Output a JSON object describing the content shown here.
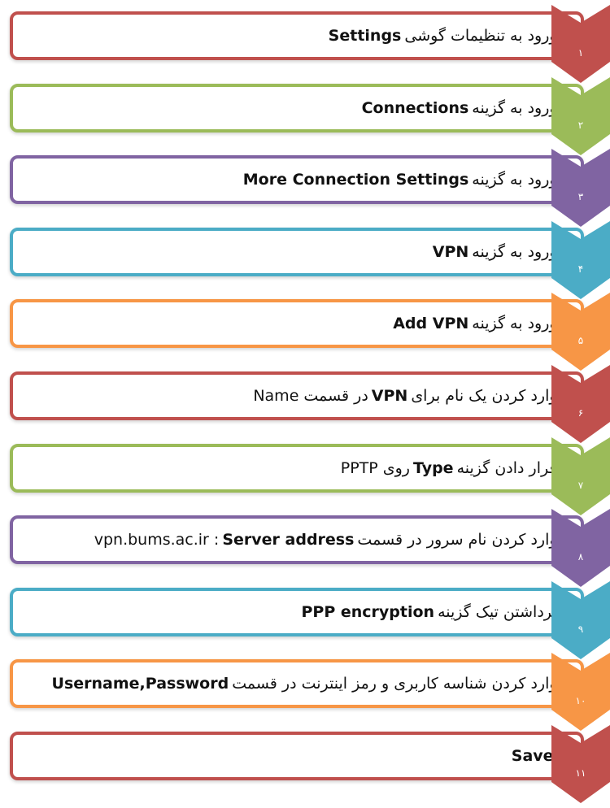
{
  "colors": {
    "red": "#c0504d",
    "green": "#9bbb59",
    "purple": "#8064a2",
    "blue": "#4bacc6",
    "orange": "#f79646"
  },
  "steps": [
    {
      "number": "۱",
      "color": "red",
      "fa": "ورود به تنظیمات گوشی",
      "en": "Settings",
      "tail": ""
    },
    {
      "number": "۲",
      "color": "green",
      "fa": "ورود به گزینه",
      "en": "Connections",
      "tail": ""
    },
    {
      "number": "۳",
      "color": "purple",
      "fa": "ورود به گزینه",
      "en": "More Connection Settings",
      "tail": ""
    },
    {
      "number": "۴",
      "color": "blue",
      "fa": "ورود به گزینه",
      "en": "VPN",
      "tail": ""
    },
    {
      "number": "۵",
      "color": "orange",
      "fa": "ورود به گزینه",
      "en": "Add VPN",
      "tail": ""
    },
    {
      "number": "۶",
      "color": "red",
      "fa": "وارد کردن یک نام برای",
      "en": "VPN",
      "tail": "در قسمت Name"
    },
    {
      "number": "۷",
      "color": "green",
      "fa": "قرار دادن گزینه",
      "en": "Type",
      "tail": "روی PPTP"
    },
    {
      "number": "۸",
      "color": "purple",
      "fa": "وارد کردن نام سرور در قسمت",
      "en": "Server address",
      "tail": ": vpn.bums.ac.ir"
    },
    {
      "number": "۹",
      "color": "blue",
      "fa": "برداشتن تیک گزینه",
      "en": "PPP encryption",
      "tail": ""
    },
    {
      "number": "۱۰",
      "color": "orange",
      "fa": "وارد کردن شناسه کاربری و رمز اینترنت در قسمت",
      "en": "Username,Password",
      "tail": ""
    },
    {
      "number": "۱۱",
      "color": "red",
      "fa": "",
      "en": "Save",
      "tail": ""
    }
  ]
}
